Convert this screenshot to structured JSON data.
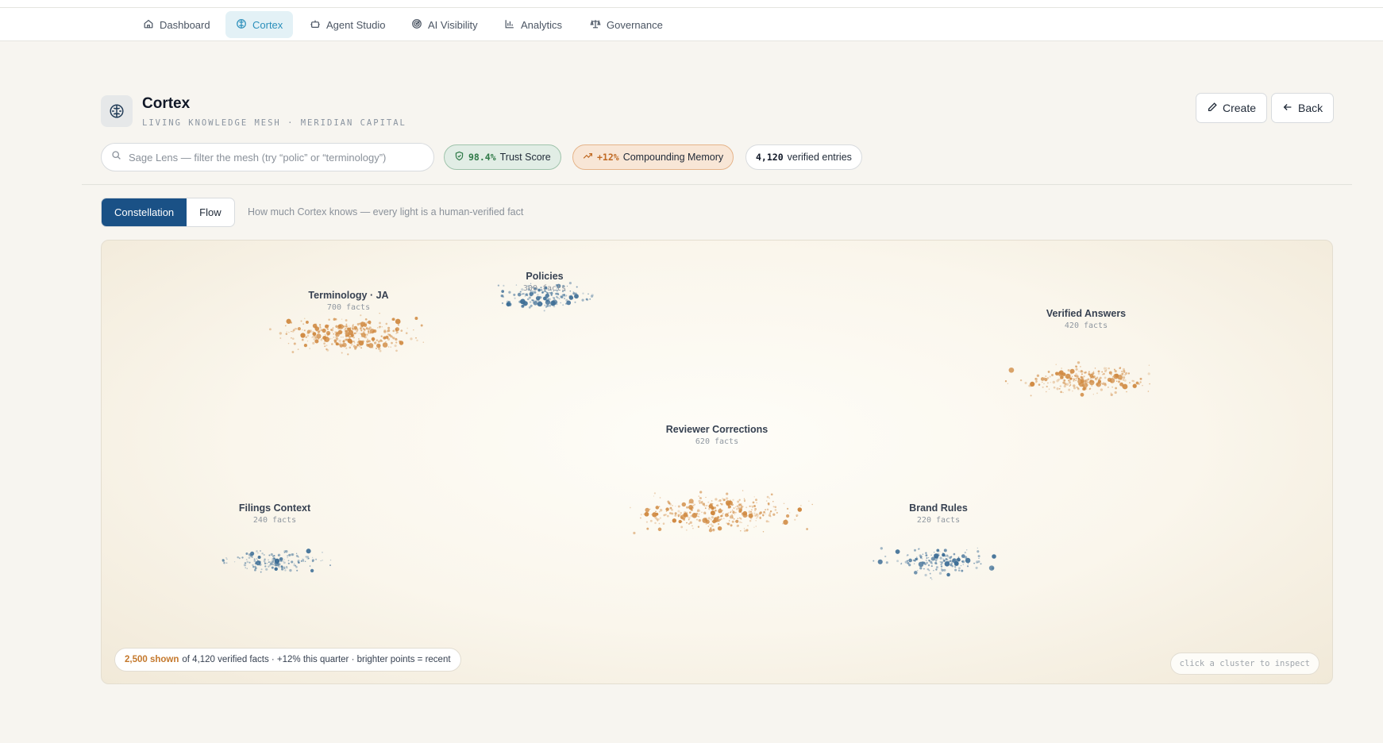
{
  "nav": {
    "items": [
      {
        "label": "Dashboard",
        "icon": "home-icon"
      },
      {
        "label": "Cortex",
        "icon": "brain-icon",
        "active": true
      },
      {
        "label": "Agent Studio",
        "icon": "bot-icon"
      },
      {
        "label": "AI Visibility",
        "icon": "radar-icon"
      },
      {
        "label": "Analytics",
        "icon": "bar-chart-icon"
      },
      {
        "label": "Governance",
        "icon": "scale-icon"
      }
    ]
  },
  "header": {
    "title": "Cortex",
    "subtitle": "LIVING KNOWLEDGE MESH · MERIDIAN CAPITAL",
    "icon": "brain-icon",
    "create_label": "Create",
    "back_label": "Back"
  },
  "search": {
    "placeholder": "Sage Lens — filter the mesh (try “polic” or “terminology”)",
    "value": ""
  },
  "stats": {
    "trust": {
      "value": "98.4%",
      "label": "Trust Score"
    },
    "memory": {
      "value": "+12%",
      "label": "Compounding Memory"
    },
    "verified": {
      "value": "4,120",
      "label": "verified entries"
    }
  },
  "view_toggle": {
    "options": [
      "Constellation",
      "Flow"
    ],
    "selected": "Constellation"
  },
  "caption": "How much Cortex knows — every light is a human-verified fact",
  "mesh": {
    "clusters": [
      {
        "name": "Terminology · JA",
        "count": "700 facts",
        "tone": "amber"
      },
      {
        "name": "Policies",
        "count": "300 facts",
        "tone": "blue"
      },
      {
        "name": "Verified Answers",
        "count": "420 facts",
        "tone": "amber"
      },
      {
        "name": "Reviewer Corrections",
        "count": "620 facts",
        "tone": "amber"
      },
      {
        "name": "Filings Context",
        "count": "240 facts",
        "tone": "blue"
      },
      {
        "name": "Brand Rules",
        "count": "220 facts",
        "tone": "blue"
      }
    ],
    "legend": {
      "highlight": "2,500 shown",
      "text": "of 4,120 verified facts · +12% this quarter · brighter points = recent"
    },
    "hint": "click a cluster to inspect"
  },
  "colors": {
    "amber": "#d08a42",
    "blue": "#3e6e96",
    "accent": "#1a5186",
    "nav_active": "#2b8fbb"
  }
}
